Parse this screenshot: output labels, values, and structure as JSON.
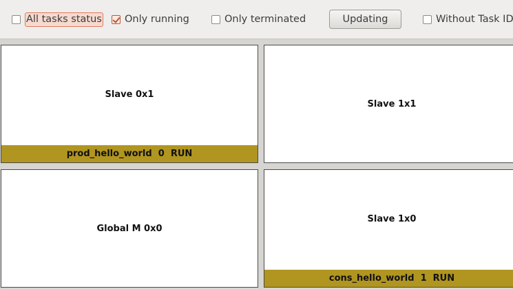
{
  "toolbar": {
    "all_tasks_status": {
      "label": "All tasks status",
      "checked": false
    },
    "only_running": {
      "label": "Only running",
      "checked": true
    },
    "only_terminated": {
      "label": "Only terminated",
      "checked": false
    },
    "updating_button": "Updating",
    "without_task_id": {
      "label": "Without Task ID",
      "checked": false
    }
  },
  "panels": {
    "slave_0x1": {
      "title": "Slave 0x1",
      "task": "prod_hello_world  0  RUN"
    },
    "slave_1x1": {
      "title": "Slave 1x1"
    },
    "global_m_0x0": {
      "title": "Global M 0x0"
    },
    "slave_1x0": {
      "title": "Slave 1x0",
      "task": "cons_hello_world  1  RUN"
    }
  },
  "colors": {
    "task_bar": "#b09520",
    "panel_bg": "#ffffff",
    "toolbar_bg": "#efeeec",
    "accent_check": "#c0532f"
  }
}
